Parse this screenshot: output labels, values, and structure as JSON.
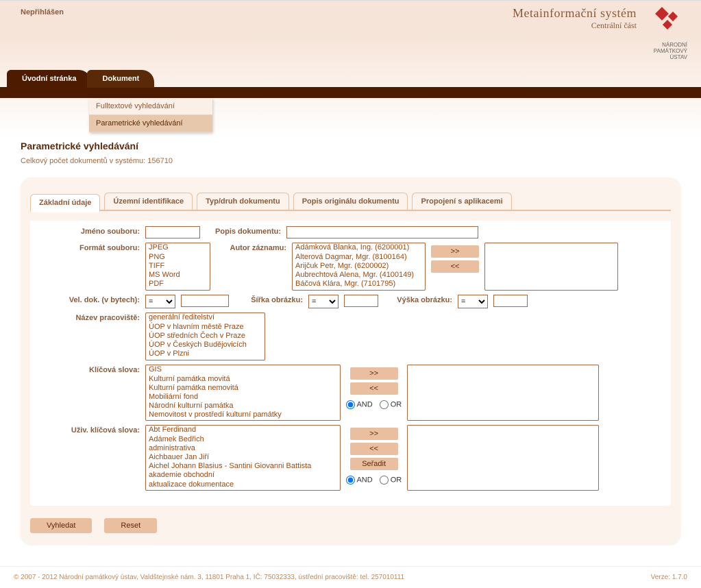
{
  "header": {
    "login_status": "Nepřihlášen",
    "brand_title": "Metainformační systém",
    "brand_sub": "Centrální část",
    "logo_label": "NÁRODNÍ PAMÁTKOVÝ ÚSTAV"
  },
  "topnav": {
    "home": "Úvodní stránka",
    "document": "Dokument"
  },
  "subnav": {
    "fulltext": "Fulltextové vyhledávání",
    "parametric": "Parametrické vyhledávání"
  },
  "page": {
    "title": "Parametrické vyhledávání",
    "total_label": "Celkový počet dokumentů v systému: 156710"
  },
  "tabs": {
    "basic": "Základní údaje",
    "territory": "Územní identifikace",
    "type": "Typ/druh dokumentu",
    "desc": "Popis originálu dokumentu",
    "links": "Propojení s aplikacemi"
  },
  "labels": {
    "filename": "Jméno souboru:",
    "docdesc": "Popis dokumentu:",
    "format": "Formát souboru:",
    "author": "Autor záznamu:",
    "size": "Vel. dok. (v bytech):",
    "width": "Šířka obrázku:",
    "height": "Výška obrázku:",
    "workplace": "Název pracoviště:",
    "keywords": "Klíčová slova:",
    "user_keywords": "Uživ. klíčová slova:",
    "and": "AND",
    "or": "OR"
  },
  "formats": [
    "JPEG",
    "PNG",
    "TIFF",
    "MS Word",
    "PDF"
  ],
  "authors": [
    "Adámková Blanka, Ing. (6200001)",
    "Alterová Dagmar, Mgr. (8100164)",
    "Arijčuk Petr, Mgr. (6200002)",
    "Aubrechtová Alena, Mgr. (4100149)",
    "Báčová Klára, Mgr. (7101795)"
  ],
  "workplaces": [
    "generální ředitelství",
    "ÚOP v hlavním městě Praze",
    "ÚOP středních Čech v Praze",
    "ÚOP v Českých Budějovicích",
    "ÚOP v Plzni"
  ],
  "keywords": [
    "GIS",
    "Kulturní památka movitá",
    "Kulturní památka nemovitá",
    "Mobiliární fond",
    "Národní kulturní památka",
    "Nemovitost v prostředí kulturní památky"
  ],
  "user_keywords": [
    "Abt Ferdinand",
    "Adámek Bedřich",
    "administrativa",
    "Aichbauer Jan Jiří",
    "Aichel Johann Blasius - Santini Giovanni Battista",
    "akademie obchodní",
    "aktualizace dokumentace"
  ],
  "operators": [
    "=",
    "<",
    ">"
  ],
  "buttons": {
    "add": ">>",
    "remove": "<<",
    "sort": "Seřadit",
    "search": "Vyhledat",
    "reset": "Reset"
  },
  "footer": {
    "copyright": "© 2007 - 2012 Národní památkový ústav, Valdštejnské nám. 3, 11801 Praha 1, IČ: 75032333, ústřední pracoviště: tel. 257010111",
    "version": "Verze: 1.7.0"
  }
}
